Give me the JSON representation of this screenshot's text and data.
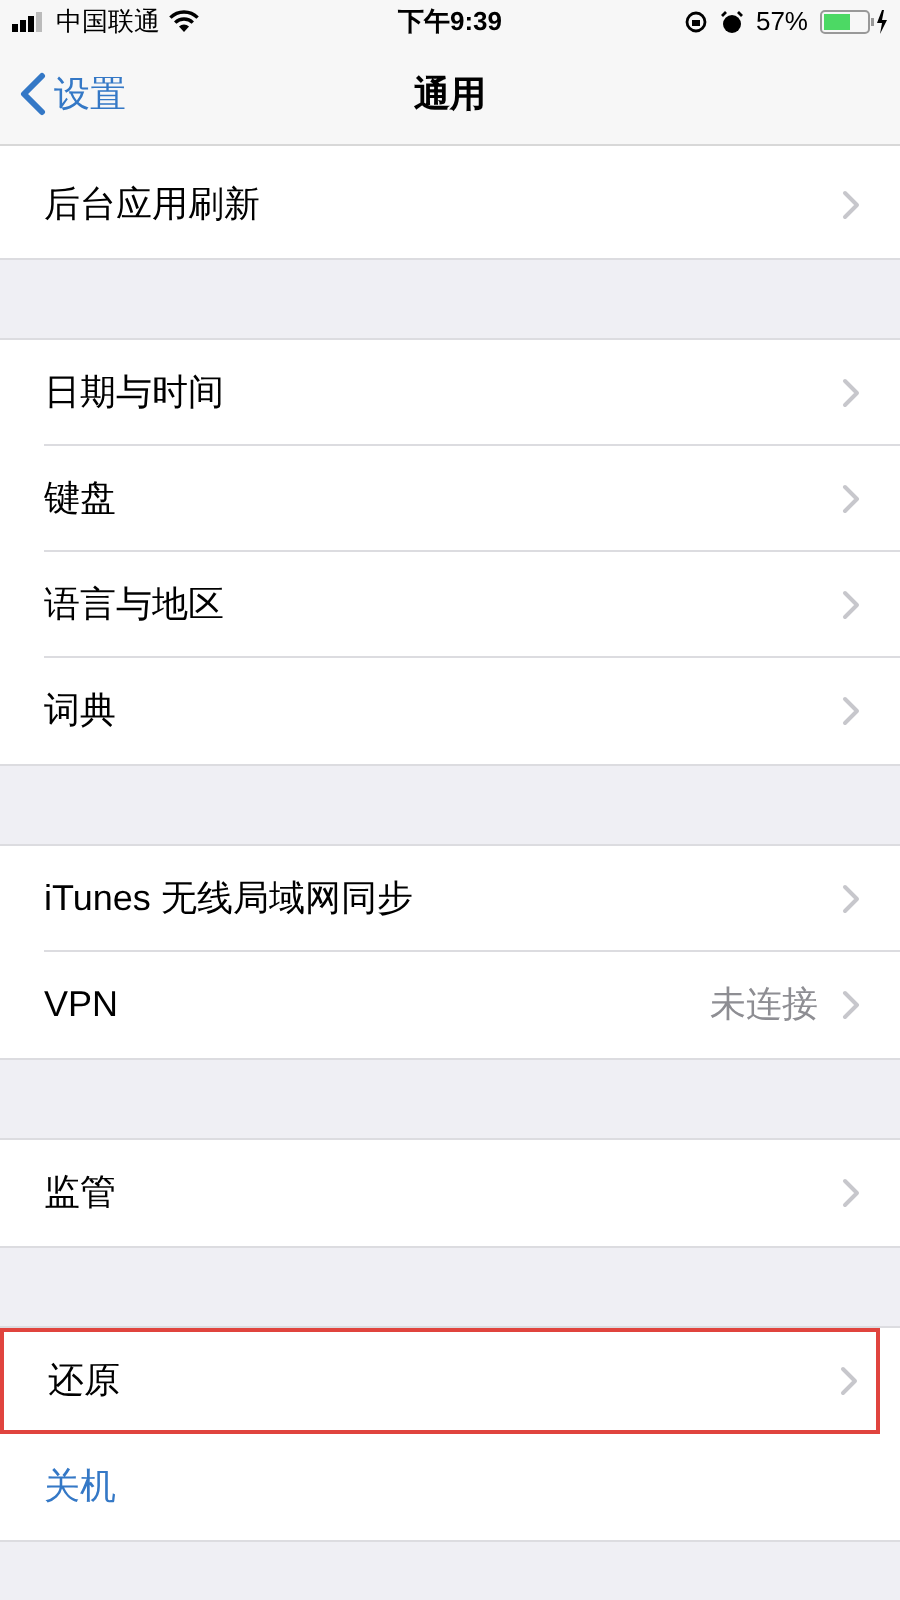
{
  "status_bar": {
    "carrier": "中国联通",
    "time": "下午9:39",
    "battery": "57%"
  },
  "nav": {
    "back": "设置",
    "title": "通用"
  },
  "groups": [
    {
      "rows": [
        {
          "label": "后台应用刷新",
          "kind": "link",
          "highlighted": false
        }
      ]
    },
    {
      "rows": [
        {
          "label": "日期与时间",
          "kind": "link",
          "highlighted": false
        },
        {
          "label": "键盘",
          "kind": "link",
          "highlighted": false
        },
        {
          "label": "语言与地区",
          "kind": "link",
          "highlighted": false
        },
        {
          "label": "词典",
          "kind": "link",
          "highlighted": false
        }
      ]
    },
    {
      "rows": [
        {
          "label": "iTunes 无线局域网同步",
          "kind": "link",
          "highlighted": false
        },
        {
          "label": "VPN",
          "detail": "未连接",
          "kind": "link",
          "highlighted": false
        }
      ]
    },
    {
      "rows": [
        {
          "label": "监管",
          "kind": "link",
          "highlighted": false
        }
      ]
    },
    {
      "rows": [
        {
          "label": "还原",
          "kind": "link",
          "highlighted": true
        },
        {
          "label": "关机",
          "kind": "action",
          "highlighted": false
        }
      ]
    }
  ]
}
